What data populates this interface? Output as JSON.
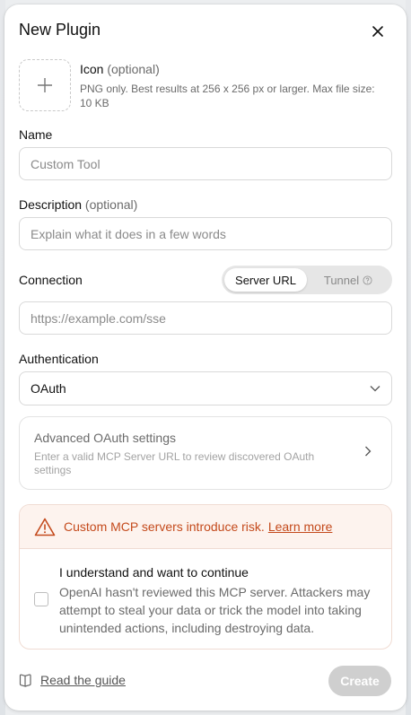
{
  "dialog": {
    "title": "New Plugin"
  },
  "icon_field": {
    "label": "Icon",
    "optional": "(optional)",
    "help": "PNG only. Best results at 256 x 256 px or larger. Max file size: 10 KB"
  },
  "name_field": {
    "label": "Name",
    "placeholder": "Custom Tool",
    "value": ""
  },
  "description_field": {
    "label": "Description",
    "optional": "(optional)",
    "placeholder": "Explain what it does in a few words",
    "value": ""
  },
  "connection": {
    "label": "Connection",
    "options": [
      "Server URL",
      "Tunnel"
    ],
    "selected": "Server URL",
    "url_placeholder": "https://example.com/sse",
    "url_value": ""
  },
  "authentication": {
    "label": "Authentication",
    "selected": "OAuth"
  },
  "advanced_oauth": {
    "title": "Advanced OAuth settings",
    "description": "Enter a valid MCP Server URL to review discovered OAuth settings"
  },
  "risk": {
    "warning": "Custom MCP servers introduce risk.",
    "link": "Learn more",
    "ack_title": "I understand and want to continue",
    "ack_desc": "OpenAI hasn't reviewed this MCP server. Attackers may attempt to steal your data or trick the model into taking unintended actions, including destroying data.",
    "checked": false
  },
  "footer": {
    "guide_link": "Read the guide",
    "create_label": "Create"
  },
  "colors": {
    "warning": "#c44a1c",
    "warning_bg": "#fdf3ee",
    "disabled_button": "#cfcfcf"
  }
}
